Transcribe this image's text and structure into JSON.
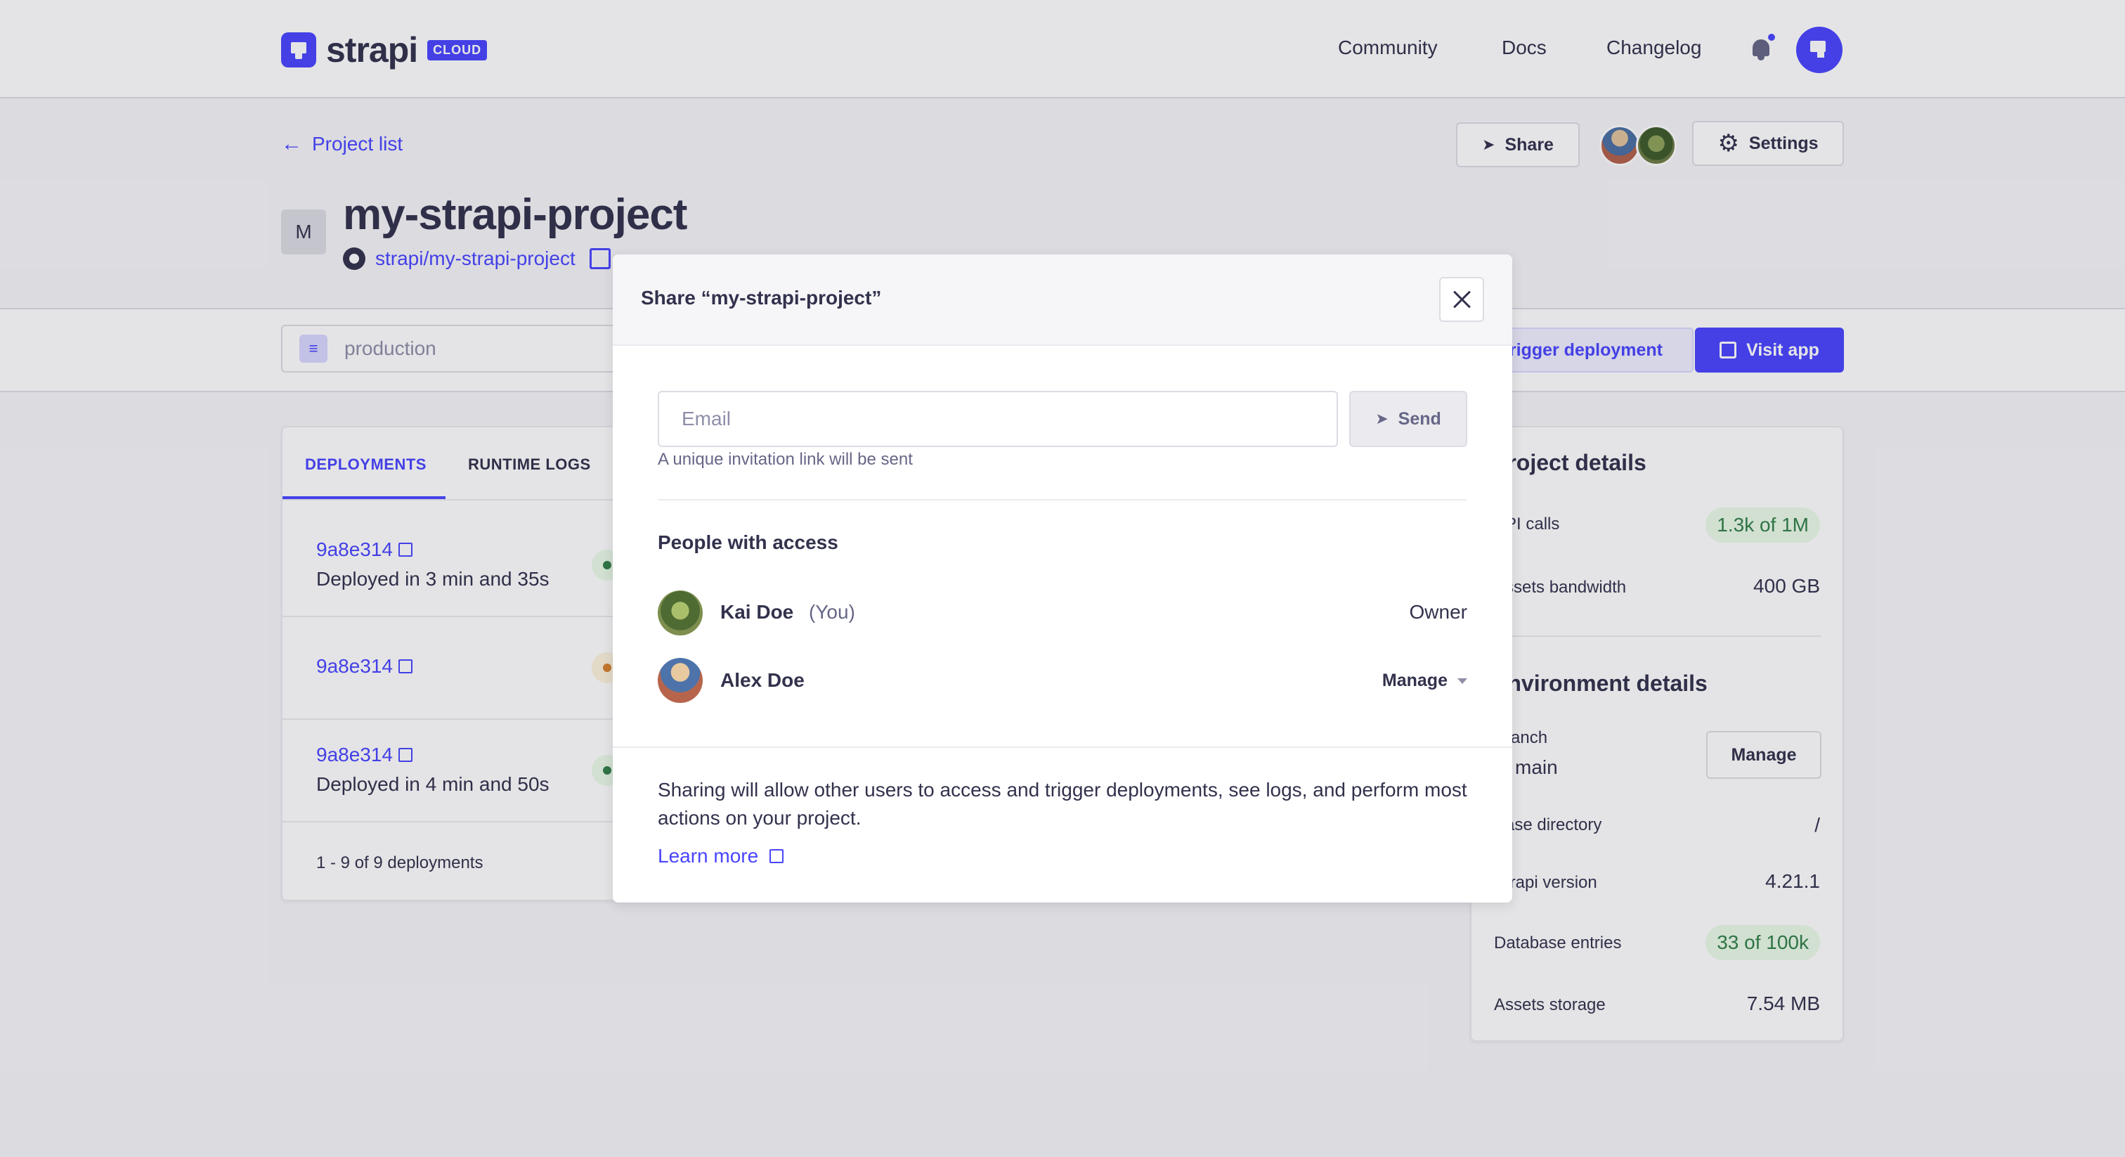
{
  "brand": {
    "name": "strapi",
    "badge": "CLOUD"
  },
  "topnav": {
    "community": "Community",
    "docs": "Docs",
    "changelog": "Changelog"
  },
  "project": {
    "back_label": "Project list",
    "initial": "M",
    "name": "my-strapi-project",
    "repo": "strapi/my-strapi-project",
    "share_label": "Share",
    "settings_label": "Settings"
  },
  "environment": {
    "selected": "production",
    "trigger_label": "Trigger deployment",
    "visit_label": "Visit app"
  },
  "deployments": {
    "tabs": [
      "DEPLOYMENTS",
      "RUNTIME LOGS"
    ],
    "rows": [
      {
        "commit": "9a8e314",
        "desc": "Deployed in 3 min and 35s",
        "status": "success"
      },
      {
        "commit": "9a8e314",
        "desc": "",
        "status": "in-progress"
      },
      {
        "commit": "9a8e314",
        "desc": "Deployed in 4 min and 50s",
        "status": "success"
      }
    ],
    "pagination": "1 - 9 of 9 deployments"
  },
  "details": {
    "project_heading": "Project details",
    "api_calls_label": "API calls",
    "api_calls_value": "1.3k of 1M",
    "bandwidth_label": "Assets bandwidth",
    "bandwidth_value": "400 GB",
    "env_heading": "Environment details",
    "branch_label": "Branch",
    "branch_value": "main",
    "manage_label": "Manage",
    "base_dir_label": "Base directory",
    "base_dir_value": "/",
    "strapi_version_label": "Strapi version",
    "strapi_version_value": "4.21.1",
    "db_entries_label": "Database entries",
    "db_entries_value": "33 of 100k",
    "storage_label": "Assets storage",
    "storage_value": "7.54 MB"
  },
  "modal": {
    "title": "Share “my-strapi-project”",
    "email_placeholder": "Email",
    "send_label": "Send",
    "hint": "A unique invitation link will be sent",
    "people_heading": "People with access",
    "people": [
      {
        "name": "Kai Doe",
        "suffix": "(You)",
        "role": "Owner"
      },
      {
        "name": "Alex Doe",
        "role_select": "Manage"
      }
    ],
    "footer_text": "Sharing will allow other users to access and trigger deployments, see logs, and perform most actions on your project.",
    "learn_more": "Learn more"
  },
  "colors": {
    "accent": "#4945ff",
    "success": "#328048",
    "warning": "#d9822f",
    "text": "#32324d"
  }
}
